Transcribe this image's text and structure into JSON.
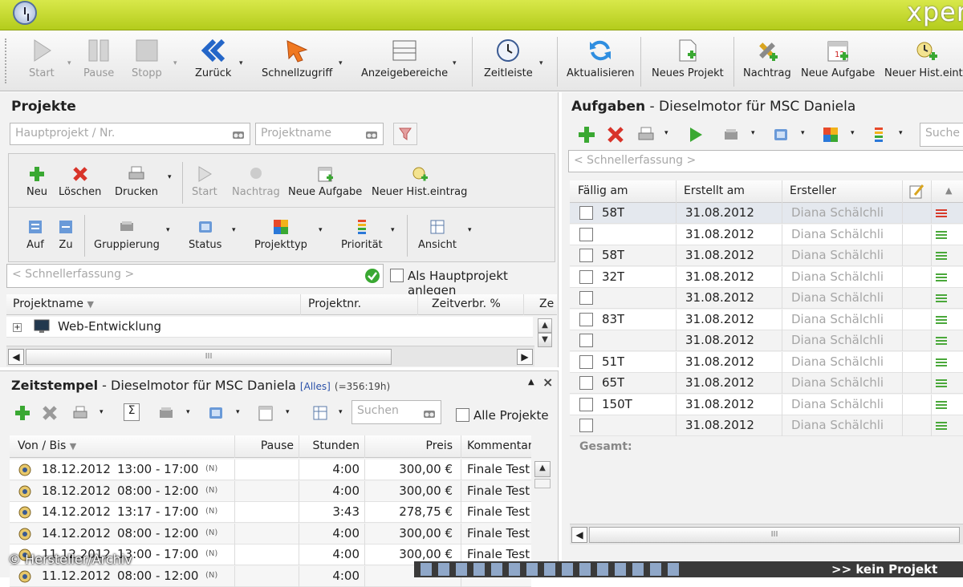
{
  "app": {
    "brand": "xper"
  },
  "toolbar": {
    "items": [
      "Start",
      "Pause",
      "Stopp",
      "Zurück",
      "Schnellzugriff",
      "Anzeigebereiche",
      "Zeitleiste",
      "Aktualisieren",
      "Neues Projekt",
      "Nachtrag",
      "Neue Aufgabe",
      "Neuer Hist.eintr."
    ]
  },
  "projekte": {
    "title": "Projekte",
    "search1_placeholder": "Hauptprojekt / Nr.",
    "search2_placeholder": "Projektname",
    "toolbar1": [
      "Neu",
      "Löschen",
      "Drucken",
      "Start",
      "Nachtrag",
      "Neue Aufgabe",
      "Neuer Hist.eintrag"
    ],
    "toolbar2": [
      "Auf",
      "Zu",
      "Gruppierung",
      "Status",
      "Projekttyp",
      "Priorität",
      "Ansicht"
    ],
    "quick_placeholder": "< Schnellerfassung >",
    "hauptprojekt_label": "Als Hauptprojekt anlegen",
    "columns": [
      "Projektname",
      "Projektnr.",
      "Zeitverbr. %",
      "Ze"
    ],
    "rows": [
      {
        "name": "Web-Entwicklung"
      }
    ],
    "scroll_thumb": "III"
  },
  "zeitstempel": {
    "title": "Zeitstempel",
    "subtitle": "- Dieselmotor für MSC Daniela",
    "filter": "[Alles]",
    "total": "(=356:19h)",
    "search_placeholder": "Suchen",
    "alle_projekte_label": "Alle Projekte",
    "columns": [
      "Von / Bis",
      "Pause",
      "Stunden",
      "Preis",
      "Kommentar"
    ],
    "rows": [
      {
        "date": "18.12.2012",
        "time": "13:00 - 17:00",
        "flag": "(N)",
        "hours": "4:00",
        "price": "300,00 €",
        "comment": "Finale Test"
      },
      {
        "date": "18.12.2012",
        "time": "08:00 - 12:00",
        "flag": "(N)",
        "hours": "4:00",
        "price": "300,00 €",
        "comment": "Finale Test"
      },
      {
        "date": "14.12.2012",
        "time": "13:17 - 17:00",
        "flag": "(N)",
        "hours": "3:43",
        "price": "278,75 €",
        "comment": "Finale Test"
      },
      {
        "date": "14.12.2012",
        "time": "08:00 - 12:00",
        "flag": "(N)",
        "hours": "4:00",
        "price": "300,00 €",
        "comment": "Finale Test"
      },
      {
        "date": "11.12.2012",
        "time": "13:00 - 17:00",
        "flag": "(N)",
        "hours": "4:00",
        "price": "300,00 €",
        "comment": "Finale Test"
      },
      {
        "date": "11.12.2012",
        "time": "08:00 - 12:00",
        "flag": "(N)",
        "hours": "4:00",
        "price": "",
        "comment": ""
      }
    ]
  },
  "aufgaben": {
    "title": "Aufgaben",
    "subtitle": "- Dieselmotor für MSC Daniela",
    "search_placeholder": "Suche",
    "quick_placeholder": "< Schnellerfassung >",
    "columns": [
      "Fällig am",
      "Erstellt am",
      "Ersteller"
    ],
    "rows": [
      {
        "due": "58T",
        "created": "31.08.2012",
        "creator": "Diana Schälchli",
        "prio": "red"
      },
      {
        "due": "",
        "created": "31.08.2012",
        "creator": "Diana Schälchli",
        "prio": "green"
      },
      {
        "due": "58T",
        "created": "31.08.2012",
        "creator": "Diana Schälchli",
        "prio": "green"
      },
      {
        "due": "32T",
        "created": "31.08.2012",
        "creator": "Diana Schälchli",
        "prio": "green"
      },
      {
        "due": "",
        "created": "31.08.2012",
        "creator": "Diana Schälchli",
        "prio": "green"
      },
      {
        "due": "83T",
        "created": "31.08.2012",
        "creator": "Diana Schälchli",
        "prio": "green"
      },
      {
        "due": "",
        "created": "31.08.2012",
        "creator": "Diana Schälchli",
        "prio": "green"
      },
      {
        "due": "51T",
        "created": "31.08.2012",
        "creator": "Diana Schälchli",
        "prio": "green"
      },
      {
        "due": "65T",
        "created": "31.08.2012",
        "creator": "Diana Schälchli",
        "prio": "green"
      },
      {
        "due": "150T",
        "created": "31.08.2012",
        "creator": "Diana Schälchli",
        "prio": "green"
      },
      {
        "due": "",
        "created": "31.08.2012",
        "creator": "Diana Schälchli",
        "prio": "green"
      }
    ],
    "total_label": "Gesamt:",
    "scroll_thumb": "III"
  },
  "statusbar": {
    "text": ">> kein Projekt"
  },
  "watermark": "© Hersteller/Archiv",
  "colors": {
    "titlebar": "#c4d62a",
    "prio_red": "#d83a2a",
    "prio_green": "#4aa83a"
  }
}
